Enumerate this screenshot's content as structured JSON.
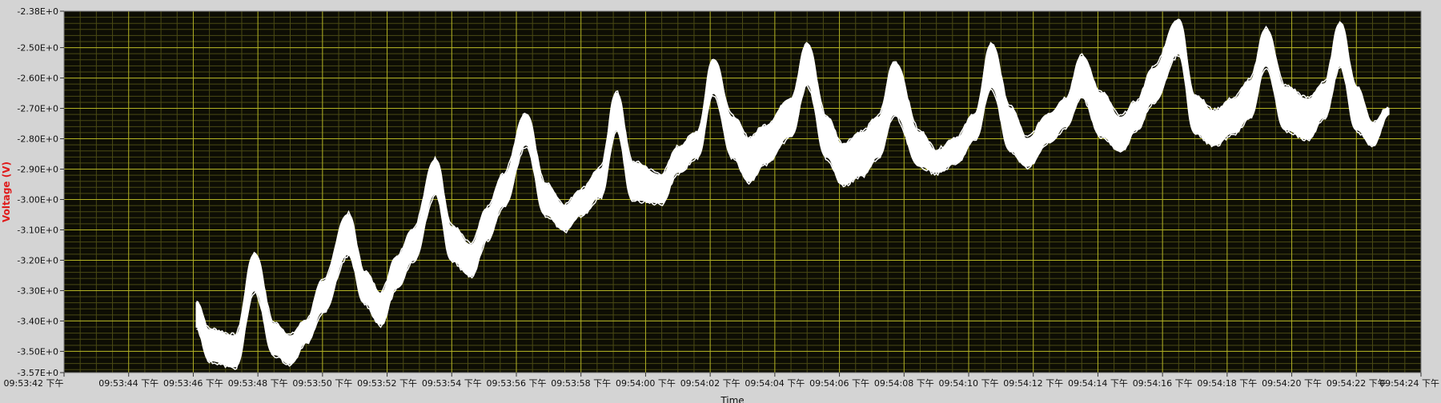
{
  "chart_data": {
    "type": "line",
    "title": "",
    "ylabel": "Voltage (V)",
    "xlabel": "Time",
    "ylim": [
      -3.57,
      -2.38
    ],
    "y_ticks": [
      "-2.38E+0",
      "-2.50E+0",
      "-2.60E+0",
      "-2.70E+0",
      "-2.80E+0",
      "-2.90E+0",
      "-3.00E+0",
      "-3.10E+0",
      "-3.20E+0",
      "-3.30E+0",
      "-3.40E+0",
      "-3.50E+0",
      "-3.57E+0"
    ],
    "y_tick_values": [
      -2.38,
      -2.5,
      -2.6,
      -2.7,
      -2.8,
      -2.9,
      -3.0,
      -3.1,
      -3.2,
      -3.3,
      -3.4,
      -3.5,
      -3.57
    ],
    "x_ticks": [
      "09:53:42 下午",
      "09:53:44 下午",
      "09:53:46 下午",
      "09:53:48 下午",
      "09:53:50 下午",
      "09:53:52 下午",
      "09:53:54 下午",
      "09:53:56 下午",
      "09:53:58 下午",
      "09:54:00 下午",
      "09:54:02 下午",
      "09:54:04 下午",
      "09:54:06 下午",
      "09:54:08 下午",
      "09:54:10 下午",
      "09:54:12 下午",
      "09:54:14 下午",
      "09:54:16 下午",
      "09:54:18 下午",
      "09:54:20 下午",
      "09:54:22 下午",
      "09:54:24 下午"
    ],
    "xlim_seconds": [
      0,
      42
    ],
    "grid": true,
    "colors": {
      "plot_bg": "#0d0d04",
      "grid_major": "#b3b324",
      "grid_minor": "#4a4a14",
      "trace": "#ffffff"
    },
    "series": [
      {
        "x": [
          4.1,
          4.5,
          5.3,
          5.9,
          6.5,
          7.0,
          7.5,
          8.0,
          8.8,
          9.3,
          9.8,
          10.3,
          10.8,
          11.5,
          12.0,
          12.6,
          13.1,
          13.6,
          14.3,
          14.9,
          15.5,
          16.0,
          16.6,
          17.1,
          17.6,
          18.5,
          19.0,
          19.6,
          20.1,
          20.7,
          21.2,
          21.7,
          22.5,
          23.0,
          23.6,
          24.1,
          24.7,
          25.2,
          25.7,
          26.5,
          27.0,
          27.6,
          28.2,
          28.7,
          29.3,
          29.8,
          30.5,
          31.0,
          31.5,
          32.1,
          32.7,
          33.2,
          33.7,
          34.5,
          35.0,
          35.6,
          36.2,
          36.7,
          37.2,
          37.8,
          38.5,
          39.0,
          39.5,
          40.0,
          40.5,
          41.0
        ],
        "upper": [
          -3.34,
          -3.43,
          -3.45,
          -3.18,
          -3.41,
          -3.45,
          -3.4,
          -3.27,
          -3.05,
          -3.24,
          -3.31,
          -3.19,
          -3.1,
          -2.87,
          -3.09,
          -3.15,
          -3.03,
          -2.92,
          -2.72,
          -2.95,
          -3.02,
          -2.97,
          -2.9,
          -2.65,
          -2.88,
          -2.92,
          -2.83,
          -2.78,
          -2.54,
          -2.73,
          -2.8,
          -2.76,
          -2.67,
          -2.49,
          -2.73,
          -2.82,
          -2.78,
          -2.73,
          -2.55,
          -2.78,
          -2.84,
          -2.8,
          -2.72,
          -2.49,
          -2.7,
          -2.8,
          -2.72,
          -2.67,
          -2.53,
          -2.65,
          -2.73,
          -2.68,
          -2.57,
          -2.41,
          -2.66,
          -2.71,
          -2.67,
          -2.61,
          -2.44,
          -2.63,
          -2.67,
          -2.62,
          -2.42,
          -2.63,
          -2.75,
          -2.7
        ],
        "lower": [
          -3.42,
          -3.53,
          -3.55,
          -3.3,
          -3.51,
          -3.54,
          -3.47,
          -3.37,
          -3.18,
          -3.34,
          -3.41,
          -3.29,
          -3.2,
          -2.98,
          -3.2,
          -3.25,
          -3.13,
          -3.02,
          -2.82,
          -3.05,
          -3.1,
          -3.05,
          -2.99,
          -2.77,
          -3.0,
          -3.01,
          -2.91,
          -2.86,
          -2.65,
          -2.86,
          -2.94,
          -2.88,
          -2.79,
          -2.62,
          -2.86,
          -2.95,
          -2.92,
          -2.86,
          -2.72,
          -2.89,
          -2.91,
          -2.88,
          -2.8,
          -2.63,
          -2.84,
          -2.89,
          -2.81,
          -2.76,
          -2.66,
          -2.79,
          -2.84,
          -2.77,
          -2.68,
          -2.52,
          -2.78,
          -2.82,
          -2.78,
          -2.73,
          -2.56,
          -2.77,
          -2.8,
          -2.73,
          -2.56,
          -2.77,
          -2.82,
          -2.72
        ]
      }
    ]
  }
}
